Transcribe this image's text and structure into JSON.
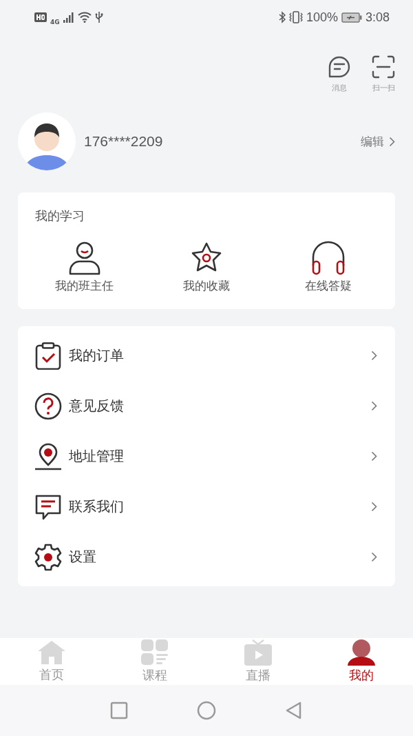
{
  "status_bar": {
    "network": "4G",
    "battery": "100%",
    "time": "3:08"
  },
  "top_actions": [
    {
      "kind": "message",
      "label": "消息"
    },
    {
      "kind": "scan",
      "label": "扫一扫"
    }
  ],
  "profile": {
    "phone": "176****2209",
    "edit": "编辑"
  },
  "my_learning": {
    "title": "我的学习",
    "items": [
      {
        "kind": "teacher",
        "label": "我的班主任"
      },
      {
        "kind": "favorite",
        "label": "我的收藏"
      },
      {
        "kind": "headset",
        "label": "在线答疑"
      }
    ]
  },
  "menu": [
    {
      "kind": "order",
      "label": "我的订单"
    },
    {
      "kind": "feedback",
      "label": "意见反馈"
    },
    {
      "kind": "address",
      "label": "地址管理"
    },
    {
      "kind": "contact",
      "label": "联系我们"
    },
    {
      "kind": "settings",
      "label": "设置"
    }
  ],
  "tab_bar": [
    {
      "kind": "home",
      "label": "首页",
      "selected": false
    },
    {
      "kind": "courses",
      "label": "课程",
      "selected": false
    },
    {
      "kind": "live",
      "label": "直播",
      "selected": false
    },
    {
      "kind": "mine",
      "label": "我的",
      "selected": true
    }
  ]
}
